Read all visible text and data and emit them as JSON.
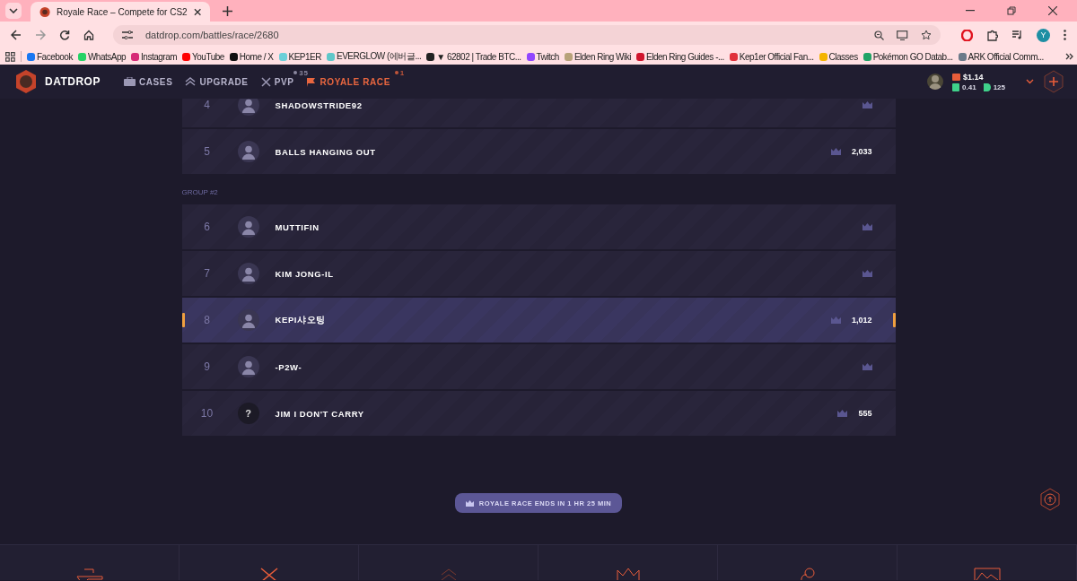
{
  "browser": {
    "tab_title": "Royale Race – Compete for CS2",
    "url": "datdrop.com/battles/race/2680",
    "profile": "Y",
    "bookmarks": [
      {
        "label": "Facebook",
        "color": "#1877f2"
      },
      {
        "label": "WhatsApp",
        "color": "#25d366"
      },
      {
        "label": "Instagram",
        "color": "#d62976"
      },
      {
        "label": "YouTube",
        "color": "#ff0000"
      },
      {
        "label": "Home / X",
        "color": "#111111"
      },
      {
        "label": "KEP1ER",
        "color": "#6ccfd8"
      },
      {
        "label": "EVERGLOW (에버글...",
        "color": "#5fc7c9"
      },
      {
        "label": "▼ 62802 | Trade BTC...",
        "color": "#222222"
      },
      {
        "label": "Twitch",
        "color": "#9146ff"
      },
      {
        "label": "Elden Ring Wiki",
        "color": "#b8a27a"
      },
      {
        "label": "Elden Ring Guides -...",
        "color": "#d0142c"
      },
      {
        "label": "Kep1er Official Fan...",
        "color": "#e0303a"
      },
      {
        "label": "Classes",
        "color": "#f4b400"
      },
      {
        "label": "Pokémon GO Datab...",
        "color": "#21a366"
      },
      {
        "label": "ARK Official Comm...",
        "color": "#6c7a8a"
      }
    ]
  },
  "site": {
    "logo": "DATDROP",
    "nav": [
      {
        "label": "CASES",
        "selected": false
      },
      {
        "label": "UPGRADE",
        "selected": false
      },
      {
        "label": "PVP",
        "badge": "35",
        "selected": false
      },
      {
        "label": "ROYALE RACE",
        "badge": "1",
        "selected": true
      }
    ],
    "balance": "$1.14",
    "coins": "0.41",
    "points": "125"
  },
  "race": {
    "rows": [
      {
        "group": null,
        "rank": "4",
        "avatar": {
          "kind": "image"
        },
        "name": "SHADOWSTRIDE92",
        "score": null,
        "selected": false
      },
      {
        "group": null,
        "rank": "5",
        "avatar": {
          "kind": "image"
        },
        "name": "BALLS HANGING OUT",
        "score": "2,033",
        "selected": false
      },
      {
        "group": "GROUP #2",
        "rank": "6",
        "avatar": {
          "kind": "image"
        },
        "name": "MUTTIFIN",
        "score": null,
        "selected": false
      },
      {
        "group": null,
        "rank": "7",
        "avatar": {
          "kind": "image"
        },
        "name": "KIM JONG-IL",
        "score": null,
        "selected": false
      },
      {
        "group": null,
        "rank": "8",
        "avatar": {
          "kind": "image"
        },
        "name": "KEPI샤오팅",
        "score": "1,012",
        "selected": true
      },
      {
        "group": null,
        "rank": "9",
        "avatar": {
          "kind": "image"
        },
        "name": "-P2W-",
        "score": null,
        "selected": false
      },
      {
        "group": null,
        "rank": "10",
        "avatar": {
          "kind": "placeholder",
          "text": "?"
        },
        "name": "JIM I DON'T CARRY",
        "score": "555",
        "selected": false
      }
    ],
    "ends": "ROYALE RACE ENDS IN 1 HR 25 MIN"
  }
}
